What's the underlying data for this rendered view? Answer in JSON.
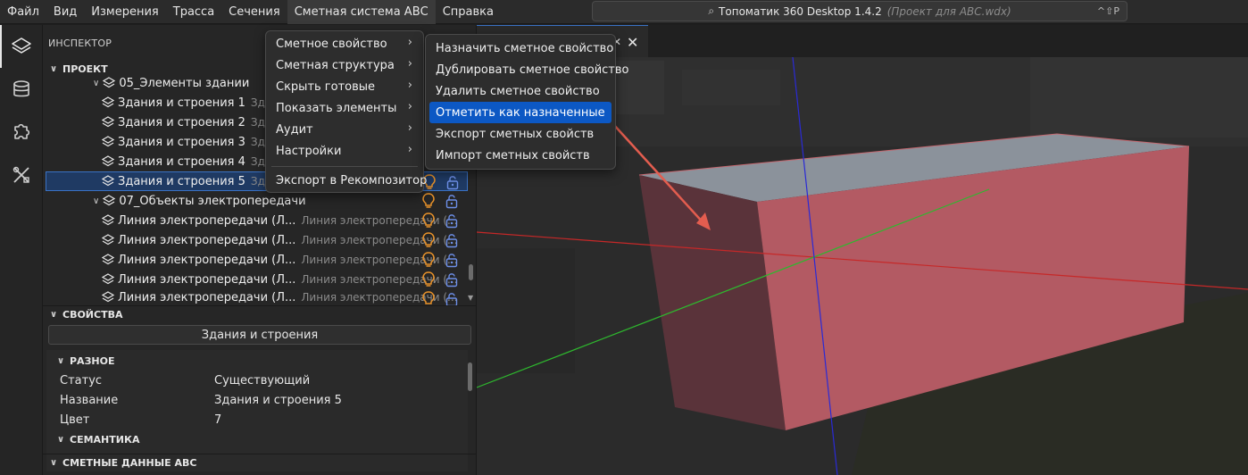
{
  "menubar": {
    "items": [
      "Файл",
      "Вид",
      "Измерения",
      "Трасса",
      "Сечения",
      "Сметная система АВС",
      "Справка"
    ]
  },
  "titlebar": {
    "app_name": "Топоматик 360 Desktop 1.4.2",
    "project": "(Проект для АВС.wdx)",
    "shortcut": "^⇧P"
  },
  "rail": {
    "icons": [
      "layers-icon",
      "database-icon",
      "puzzle-icon",
      "tools-icon"
    ]
  },
  "inspector": {
    "title": "ИНСПЕКТОР",
    "project_section": "ПРОЕКТ",
    "tree": [
      {
        "label": "05_Элементы здании",
        "hint": "",
        "group": true
      },
      {
        "label": "Здания и строения 1",
        "hint": "Здания"
      },
      {
        "label": "Здания и строения 2",
        "hint": "Здания"
      },
      {
        "label": "Здания и строения 3",
        "hint": "Здания"
      },
      {
        "label": "Здания и строения 4",
        "hint": "Здания"
      },
      {
        "label": "Здания и строения 5",
        "hint": "Здани",
        "selected": true
      },
      {
        "label": "07_Объекты электропередачи",
        "hint": "",
        "group": true
      },
      {
        "label": "Линия электропередачи (Л...",
        "hint": "Линия электропередачи (..."
      },
      {
        "label": "Линия электропередачи (Л...",
        "hint": "Линия электропередачи (..."
      },
      {
        "label": "Линия электропередачи (Л...",
        "hint": "Линия электропередачи (..."
      },
      {
        "label": "Линия электропередачи (Л...",
        "hint": "Линия электропередачи (..."
      },
      {
        "label": "Линия электропередачи (Л...",
        "hint": "Линия электропередачи (..."
      }
    ],
    "properties_section": "СВОЙСТВА",
    "object_type": "Здания и строения",
    "misc_section": "РАЗНОЕ",
    "props": [
      {
        "key": "Статус",
        "value": "Существующий"
      },
      {
        "key": "Название",
        "value": "Здания и строения 5"
      },
      {
        "key": "Цвет",
        "value": "7"
      }
    ],
    "semantics_section": "СЕМАНТИКА",
    "abc_section": "СМЕТНЫЕ ДАННЫЕ АВС"
  },
  "menu_main": {
    "items": [
      {
        "label": "Сметное свойство",
        "submenu": true
      },
      {
        "label": "Сметная структура",
        "submenu": true
      },
      {
        "label": "Скрыть готовые",
        "submenu": true
      },
      {
        "label": "Показать элементы",
        "submenu": true
      },
      {
        "label": "Аудит",
        "submenu": true
      },
      {
        "label": "Настройки",
        "submenu": true
      },
      {
        "label": "Экспорт в Рекомпозитор",
        "submenu": false
      }
    ]
  },
  "menu_sub": {
    "items": [
      "Назначить сметное свойство",
      "Дублировать сметное свойство",
      "Удалить сметное свойство",
      "Отметить как назначенные",
      "Экспорт сметных свойств",
      "Импорт сметных свойств"
    ],
    "highlighted_index": 3
  },
  "colors": {
    "accent": "#0c58c4",
    "bulb": "#e8922a",
    "lock": "#6d8fe8",
    "box_face": "#b35a63",
    "axis_x": "#c62828",
    "axis_y": "#2eb82e",
    "axis_z": "#2a2ad6"
  }
}
